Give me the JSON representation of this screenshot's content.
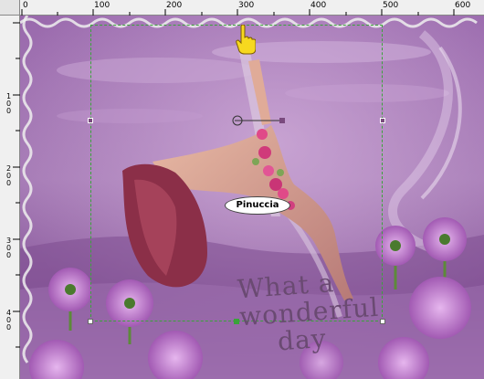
{
  "ruler": {
    "top_labels": [
      "0",
      "100",
      "200",
      "300",
      "400",
      "500",
      "600"
    ],
    "left_labels": [
      "1\n0\n0",
      "2\n0\n0",
      "3\n0\n0",
      "4\n0\n0"
    ]
  },
  "canvas": {
    "watermark": "Pinuccia",
    "text_line1": "What a",
    "text_line2": "wonderful",
    "text_line3": "day"
  },
  "colors": {
    "background": "#8a5a99",
    "selection": "#3aa33a",
    "handle": "#7a4a7e"
  },
  "icons": {
    "cursor": "hand-pointer-icon"
  }
}
